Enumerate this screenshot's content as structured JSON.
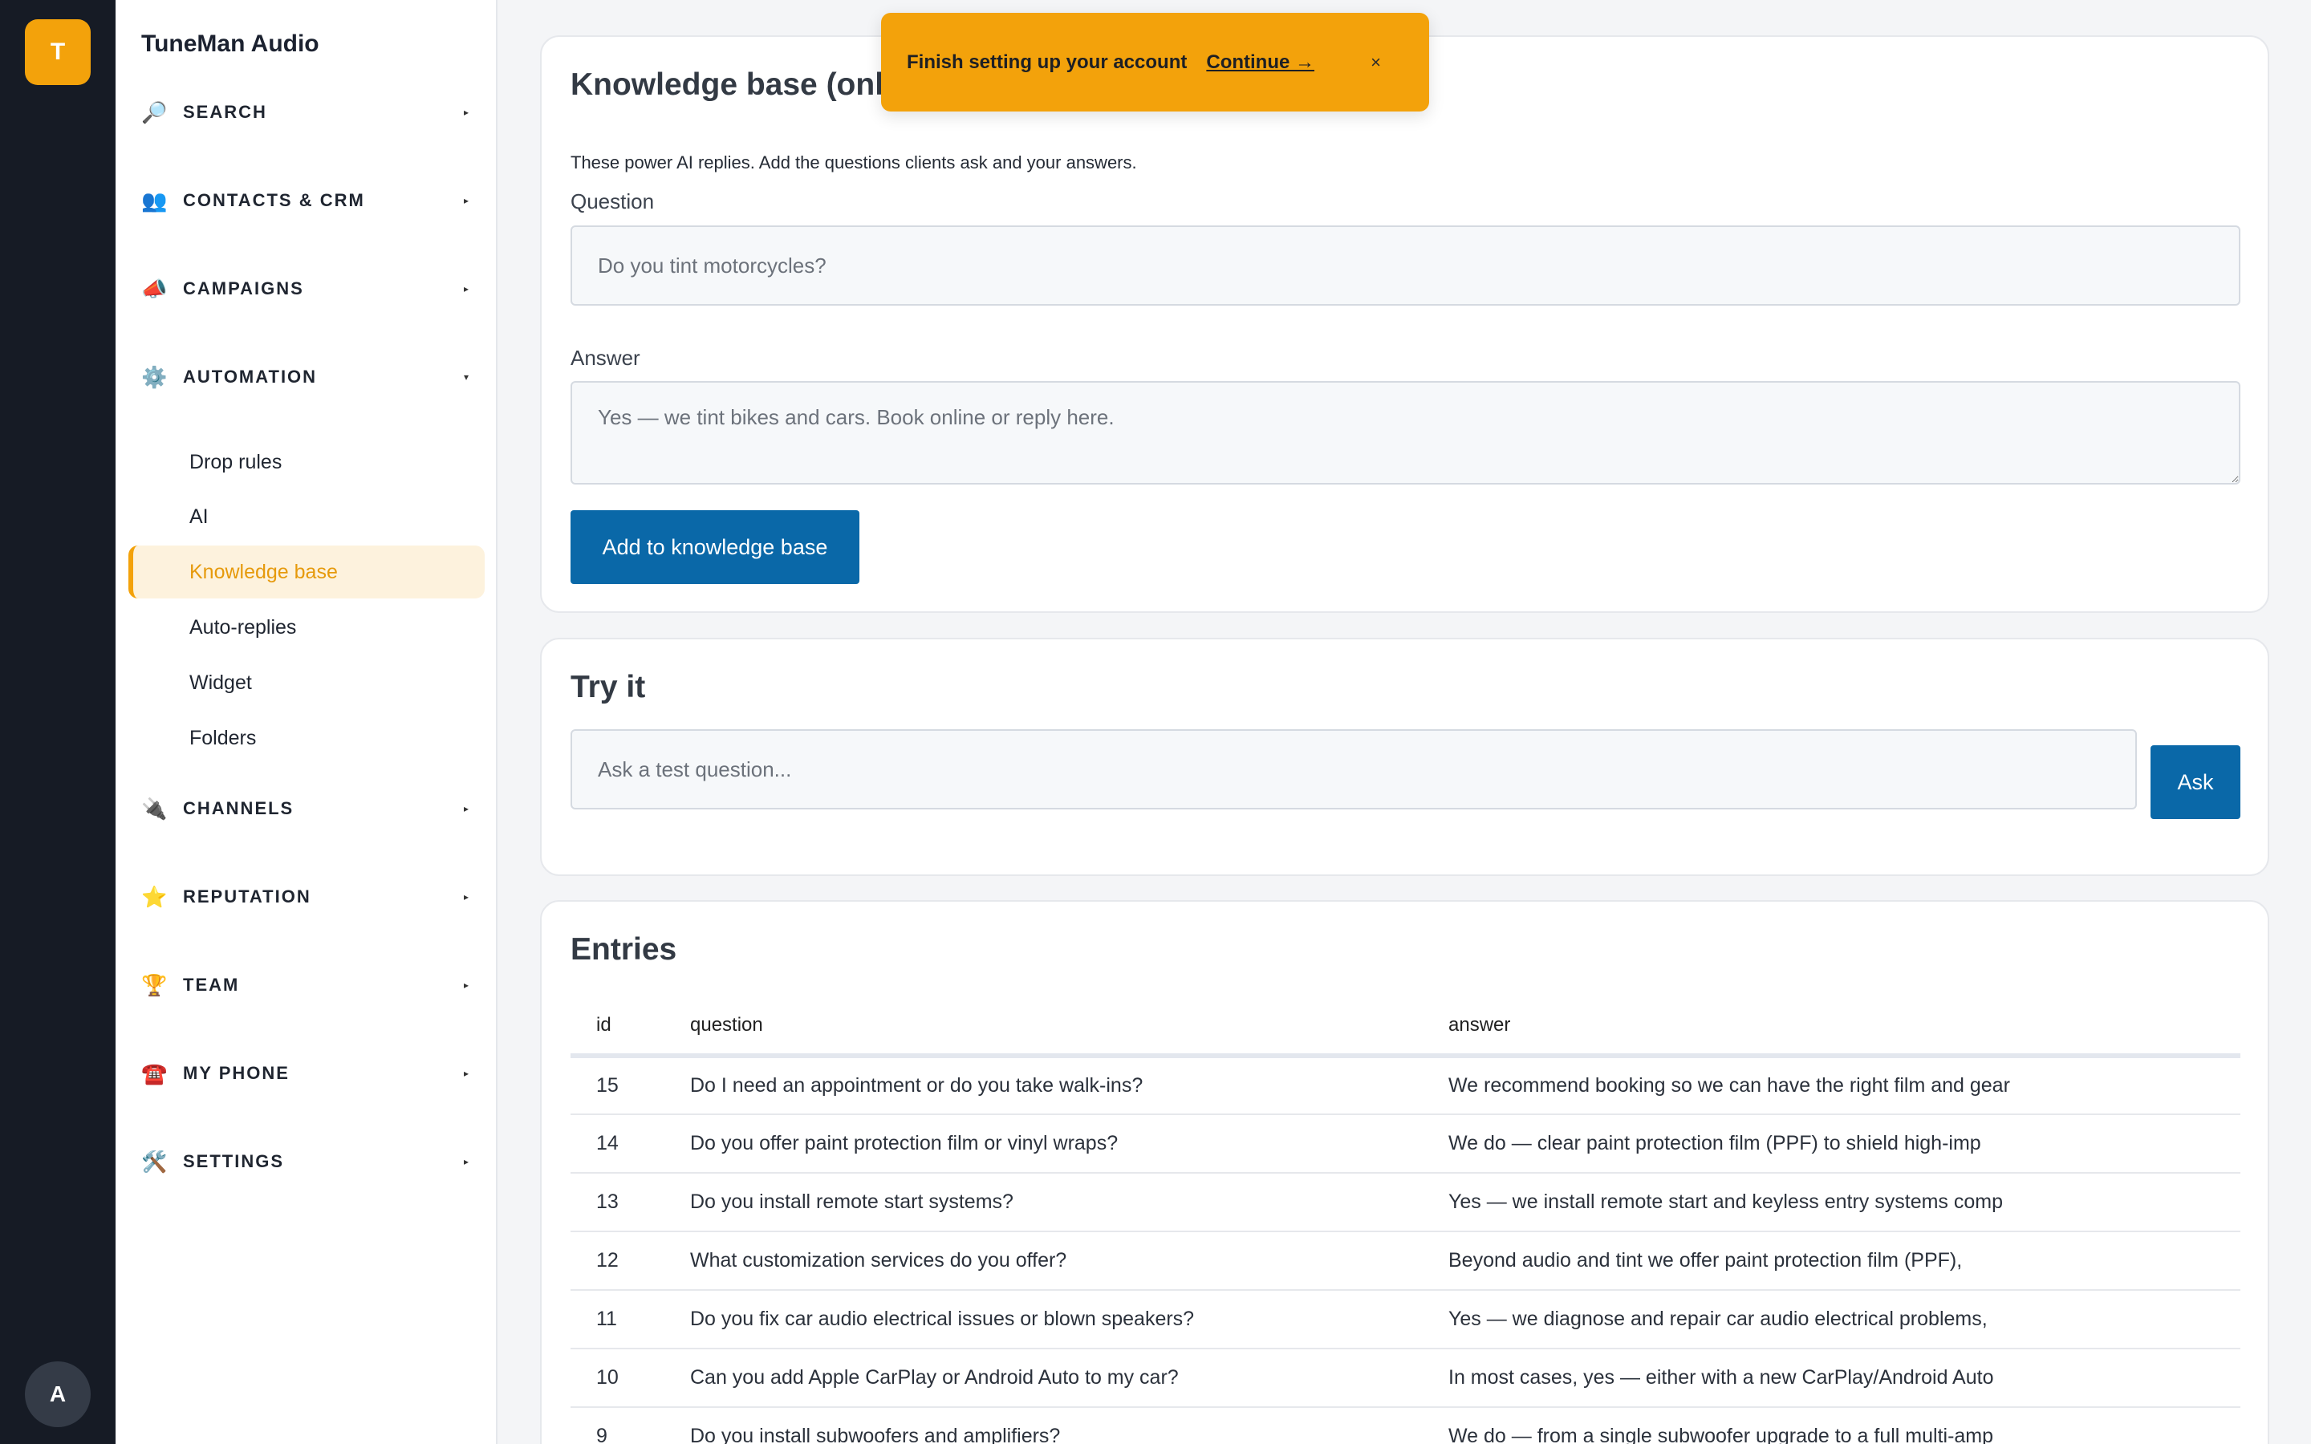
{
  "rail": {
    "logo_letter": "T",
    "avatar_letter": "A"
  },
  "sidebar": {
    "brand": "TuneMan Audio",
    "sections": [
      {
        "label": "SEARCH",
        "icon": "search-icon",
        "glyph": "🔎"
      },
      {
        "label": "CONTACTS & CRM",
        "icon": "contacts-icon",
        "glyph": "👥"
      },
      {
        "label": "CAMPAIGNS",
        "icon": "megaphone-icon",
        "glyph": "📣"
      },
      {
        "label": "AUTOMATION",
        "icon": "gear-icon",
        "glyph": "⚙️"
      },
      {
        "label": "CHANNELS",
        "icon": "plug-icon",
        "glyph": "🔌"
      },
      {
        "label": "REPUTATION",
        "icon": "star-icon",
        "glyph": "⭐"
      },
      {
        "label": "TEAM",
        "icon": "trophy-icon",
        "glyph": "🏆"
      },
      {
        "label": "MY PHONE",
        "icon": "phone-icon",
        "glyph": "☎️"
      },
      {
        "label": "SETTINGS",
        "icon": "tools-icon",
        "glyph": "🛠️"
      }
    ],
    "automation_items": [
      "Drop rules",
      "AI",
      "Knowledge base",
      "Auto-replies",
      "Widget",
      "Folders"
    ],
    "active_item": "Knowledge base"
  },
  "toast": {
    "message": "Finish setting up your account",
    "link": "Continue →",
    "close": "×"
  },
  "kb_card": {
    "title": "Knowledge base (onl",
    "helper": "These power AI replies. Add the questions clients ask and your answers.",
    "question_label": "Question",
    "question_placeholder": "Do you tint motorcycles?",
    "answer_label": "Answer",
    "answer_placeholder": "Yes — we tint bikes and cars. Book online or reply here.",
    "add_button": "Add to knowledge base"
  },
  "try_card": {
    "title": "Try it",
    "placeholder": "Ask a test question...",
    "ask_button": "Ask"
  },
  "entries_card": {
    "title": "Entries",
    "columns": [
      "id",
      "question",
      "answer"
    ],
    "rows": [
      {
        "id": "15",
        "question": "Do I need an appointment or do you take walk-ins?",
        "answer": "We recommend booking so we can have the right film and gear"
      },
      {
        "id": "14",
        "question": "Do you offer paint protection film or vinyl wraps?",
        "answer": "We do — clear paint protection film (PPF) to shield high-imp"
      },
      {
        "id": "13",
        "question": "Do you install remote start systems?",
        "answer": "Yes — we install remote start and keyless entry systems comp"
      },
      {
        "id": "12",
        "question": "What customization services do you offer?",
        "answer": "Beyond audio and tint we offer paint protection film (PPF),"
      },
      {
        "id": "11",
        "question": "Do you fix car audio electrical issues or blown speakers?",
        "answer": "Yes — we diagnose and repair car audio electrical problems,"
      },
      {
        "id": "10",
        "question": "Can you add Apple CarPlay or Android Auto to my car?",
        "answer": "In most cases, yes — either with a new CarPlay/Android Auto"
      },
      {
        "id": "9",
        "question": "Do you install subwoofers and amplifiers?",
        "answer": "We do — from a single subwoofer upgrade to a full multi-amp"
      }
    ]
  }
}
